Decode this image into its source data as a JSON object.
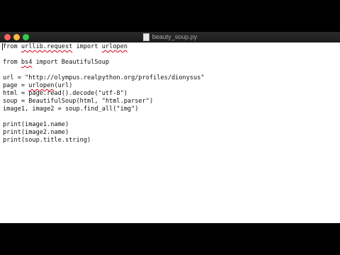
{
  "window": {
    "title": "beauty_soup.py"
  },
  "code": {
    "line1": {
      "a": "from ",
      "b": "urllib.request",
      "c": " import ",
      "d": "urlopen"
    },
    "line2": "",
    "line3": {
      "a": "from ",
      "b": "bs4",
      "c": " import BeautifulSoup"
    },
    "line4": "",
    "line5": "url = \"http://olympus.realpython.org/profiles/dionysus\"",
    "line6": {
      "a": "page = ",
      "b": "urlopen",
      "c": "(url)"
    },
    "line7": "html = page.read().decode(\"utf-8\")",
    "line8": "soup = BeautifulSoup(html, \"html.parser\")",
    "line9": "image1, image2 = soup.find_all(\"img\")",
    "line10": "",
    "line11": "print(image1.name)",
    "line12": "print(image2.name)",
    "line13": "print(soup.title.string)"
  },
  "colors": {
    "close": "#fc605c",
    "minimize": "#fdbc40",
    "zoom": "#34c84a",
    "spellcheck": "#d0021b"
  }
}
